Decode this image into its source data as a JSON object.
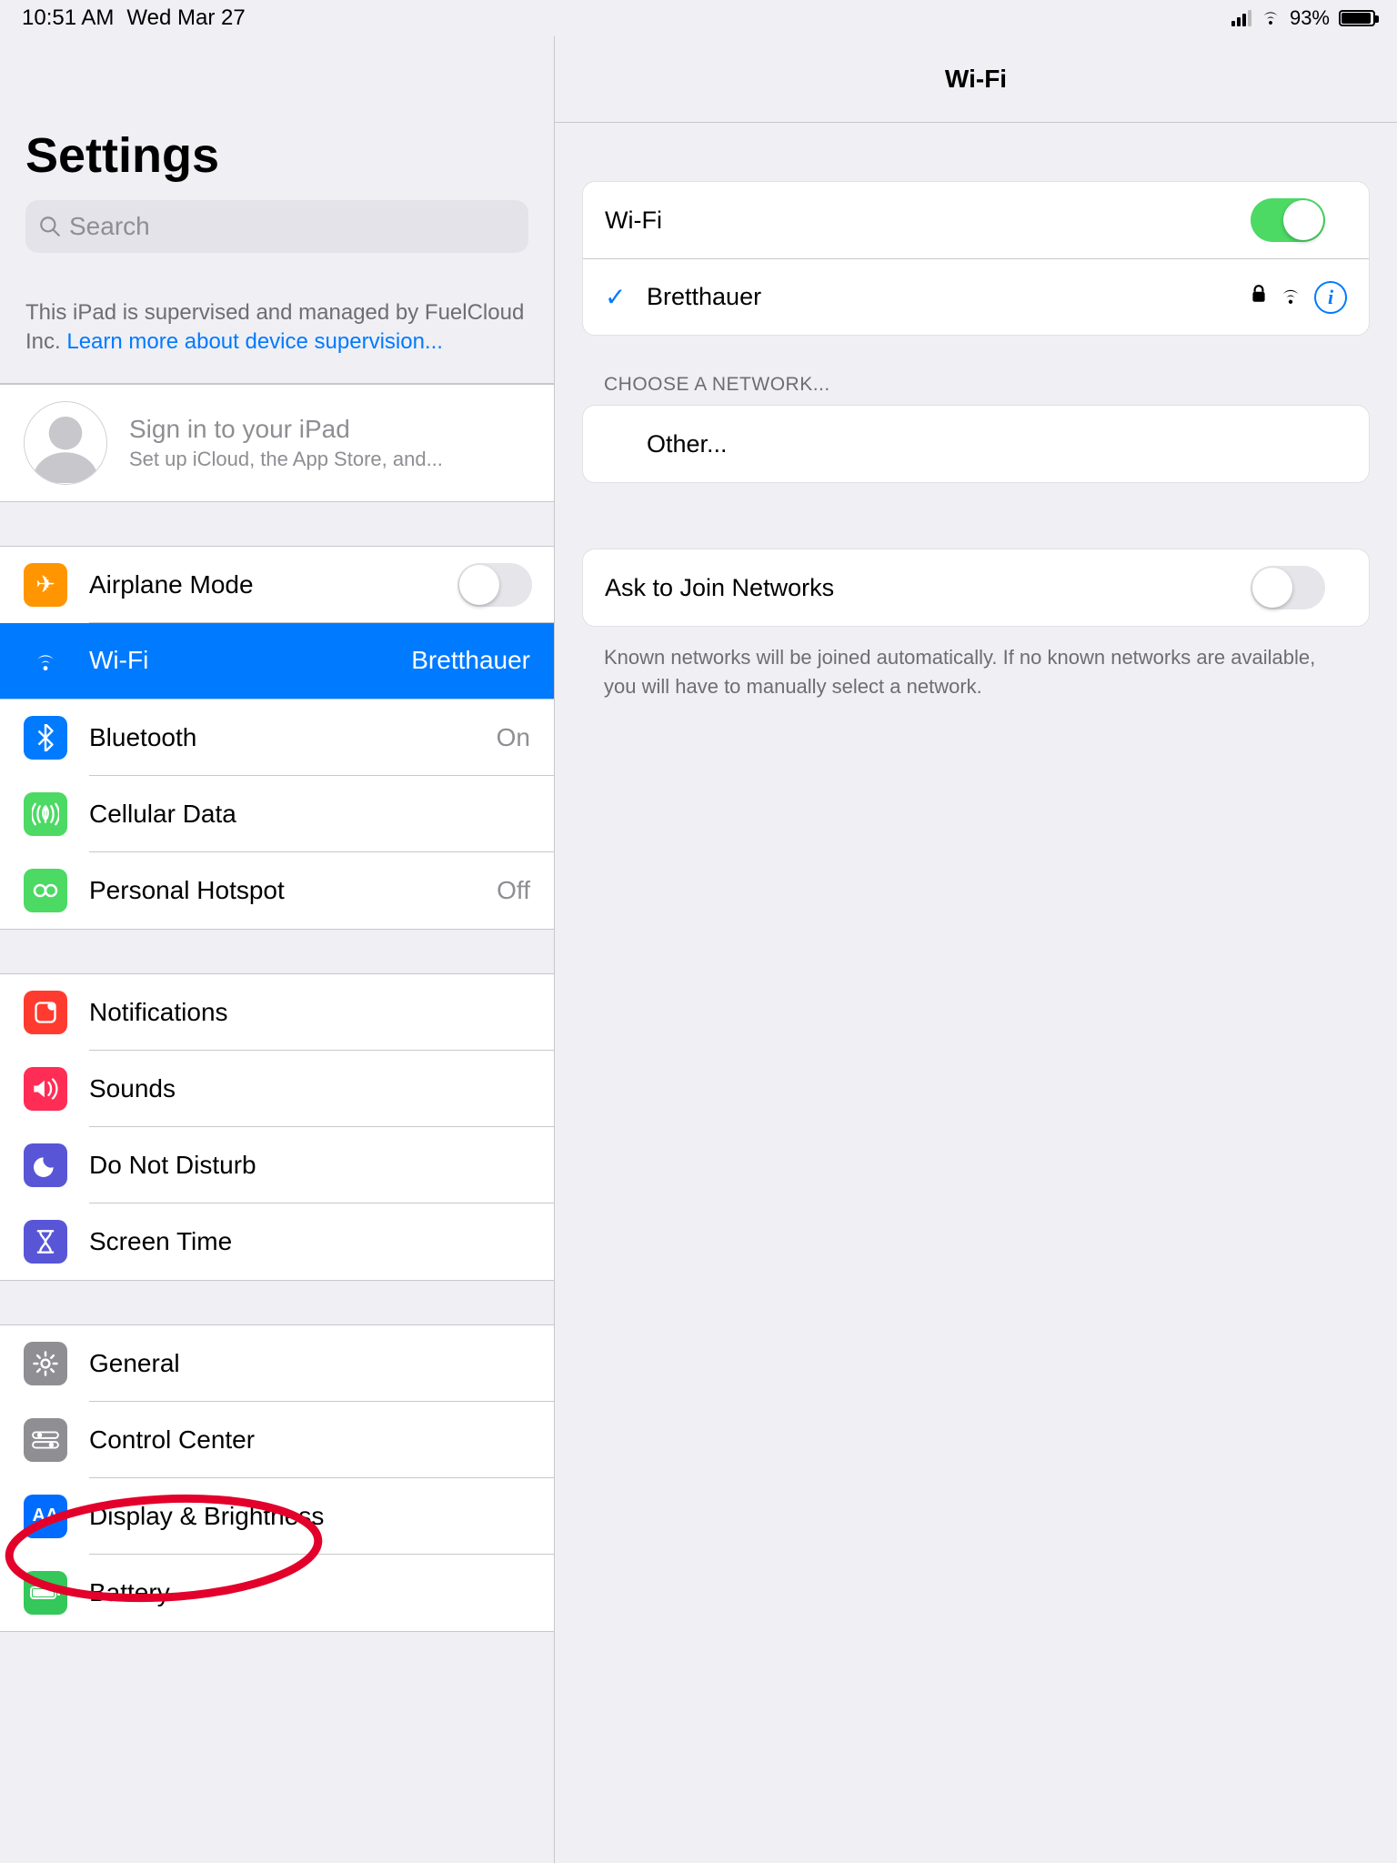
{
  "status": {
    "time": "10:51 AM",
    "date": "Wed Mar 27",
    "battery": "93%"
  },
  "sidebar": {
    "title": "Settings",
    "search_placeholder": "Search",
    "supervision_note_prefix": "This iPad is supervised and managed by FuelCloud Inc. ",
    "supervision_link": "Learn more about device supervision...",
    "signin_title": "Sign in to your iPad",
    "signin_sub": "Set up iCloud, the App Store, and...",
    "items": {
      "airplane": "Airplane Mode",
      "wifi": "Wi-Fi",
      "wifi_value": "Bretthauer",
      "bluetooth": "Bluetooth",
      "bluetooth_value": "On",
      "cellular": "Cellular Data",
      "hotspot": "Personal Hotspot",
      "hotspot_value": "Off",
      "notifications": "Notifications",
      "sounds": "Sounds",
      "dnd": "Do Not Disturb",
      "screentime": "Screen Time",
      "general": "General",
      "controlcenter": "Control Center",
      "display": "Display & Brightness",
      "battery": "Battery"
    }
  },
  "detail": {
    "title": "Wi-Fi",
    "wifi_label": "Wi-Fi",
    "connected_network": "Bretthauer",
    "choose_network": "CHOOSE A NETWORK...",
    "other": "Other...",
    "ask_join": "Ask to Join Networks",
    "ask_join_foot": "Known networks will be joined automatically. If no known networks are available, you will have to manually select a network."
  }
}
